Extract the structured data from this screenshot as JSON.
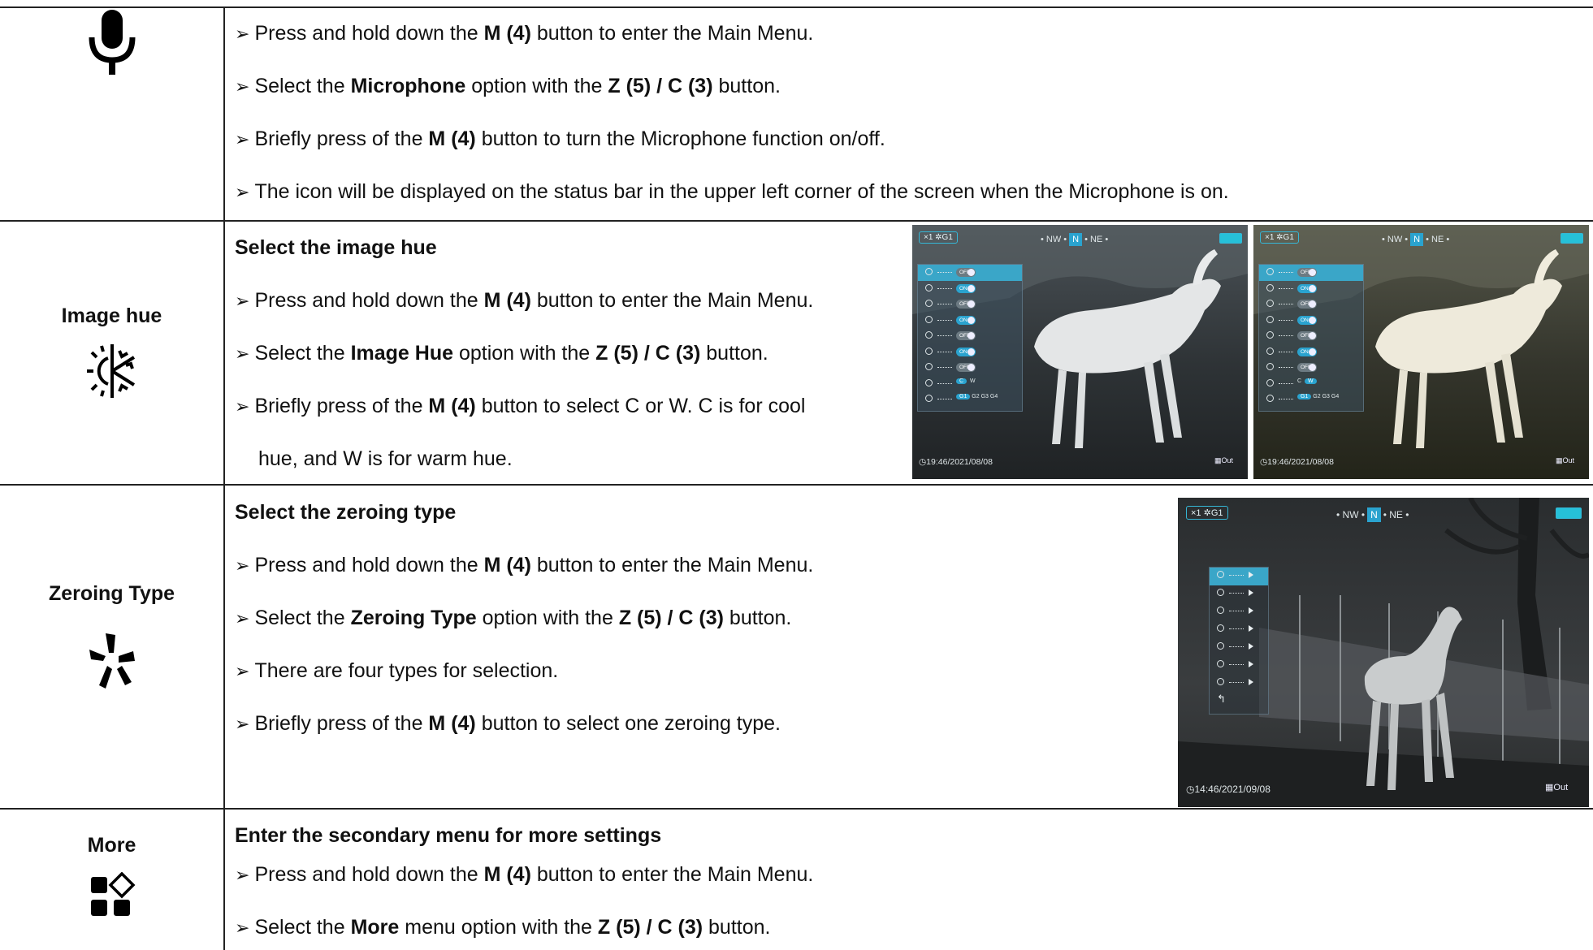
{
  "sections": {
    "microphone": {
      "lines": [
        {
          "pre": "Press and hold down the ",
          "b1": "M (4)",
          "mid": " button to enter the Main Menu.",
          "b2": "",
          "post": ""
        },
        {
          "pre": "Select the ",
          "b1": "Microphone",
          "mid": " option with the ",
          "b2": "Z (5) / C (3)",
          "post": " button."
        },
        {
          "pre": "Briefly press of the ",
          "b1": "M (4)",
          "mid": " button to turn the Microphone function on/off.",
          "b2": "",
          "post": ""
        },
        {
          "pre": "The icon will be displayed on the status bar in the upper left corner of the screen when the Microphone is on.",
          "b1": "",
          "mid": "",
          "b2": "",
          "post": ""
        }
      ]
    },
    "image_hue": {
      "label": "Image hue",
      "heading": "Select the image hue",
      "lines": [
        {
          "pre": "Press and hold down the ",
          "b1": "M (4)",
          "mid": " button to enter the Main Menu.",
          "b2": "",
          "post": ""
        },
        {
          "pre": "Select the ",
          "b1": "Image Hue",
          "mid": " option with the ",
          "b2": "Z (5) / C (3)",
          "post": " button."
        },
        {
          "pre": "Briefly press of the ",
          "b1": "M (4)",
          "mid": " button to select C or W. C is for cool",
          "b2": "",
          "post": ""
        }
      ],
      "continuation": "hue, and W is for warm hue."
    },
    "zeroing": {
      "label": "Zeroing Type",
      "heading": "Select the zeroing type",
      "lines": [
        {
          "pre": "Press and hold down the ",
          "b1": "M (4)",
          "mid": " button to enter the Main Menu.",
          "b2": "",
          "post": ""
        },
        {
          "pre": "Select the ",
          "b1": "Zeroing Type",
          "mid": " option with the ",
          "b2": "Z (5) / C (3)",
          "post": " button."
        },
        {
          "pre": "There are four types for selection.",
          "b1": "",
          "mid": "",
          "b2": "",
          "post": ""
        },
        {
          "pre": "Briefly press of the ",
          "b1": "M (4)",
          "mid": " button to select one zeroing type.",
          "b2": "",
          "post": ""
        }
      ]
    },
    "more": {
      "label": "More",
      "heading": "Enter the secondary menu for more settings",
      "lines": [
        {
          "pre": "Press and hold down the ",
          "b1": "M (4)",
          "mid": " button to enter the Main Menu.",
          "b2": "",
          "post": ""
        },
        {
          "pre": "Select the ",
          "b1": "More",
          "mid": " menu option with the ",
          "b2": "Z (5) / C (3)",
          "post": " button."
        }
      ]
    }
  },
  "screens": {
    "hue_left": {
      "status": "×1 ✲G1",
      "compass_left": "• NW •",
      "compass_n": "N",
      "compass_right": "• NE •",
      "time": "19:46/2021/08/08",
      "out": "Out",
      "toggles": [
        "OFF",
        "ON",
        "OFF",
        "ON",
        "OFF",
        "ON",
        "OFF"
      ],
      "hue_opts": {
        "a": "C",
        "b": "W",
        "sel": "a"
      },
      "gain_opts": [
        "G1",
        "G2",
        "G3",
        "G4"
      ]
    },
    "hue_right": {
      "status": "×1 ✲G1",
      "compass_left": "• NW •",
      "compass_n": "N",
      "compass_right": "• NE •",
      "time": "19:46/2021/08/08",
      "out": "Out",
      "toggles": [
        "OFF",
        "ON",
        "OFF",
        "ON",
        "OFF",
        "ON",
        "OFF"
      ],
      "hue_opts": {
        "a": "C",
        "b": "W",
        "sel": "b"
      },
      "gain_opts": [
        "G1",
        "G2",
        "G3",
        "G4"
      ]
    },
    "zeroing": {
      "status": "×1 ✲G1",
      "compass_left": "• NW •",
      "compass_n": "N",
      "compass_right": "• NE •",
      "time": "14:46/2021/09/08",
      "out": "Out"
    }
  },
  "icons": {
    "microphone": "microphone-icon",
    "image_hue": "snowflake-sun-icon",
    "zeroing": "zeroing-propeller-icon",
    "more": "more-grid-icon",
    "bullet": "➢"
  }
}
